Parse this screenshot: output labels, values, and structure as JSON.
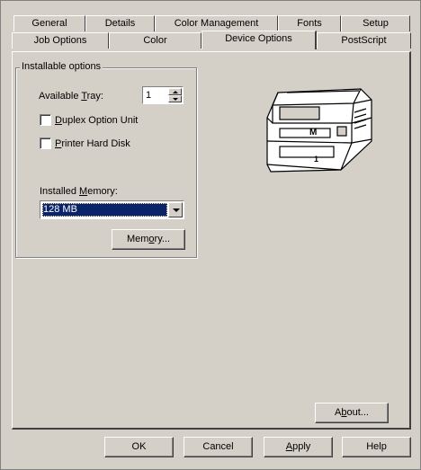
{
  "tabs_back": [
    {
      "pre": "General",
      "u": "",
      "post": ""
    },
    {
      "pre": "Details",
      "u": "",
      "post": ""
    },
    {
      "pre": "Color Management",
      "u": "",
      "post": ""
    },
    {
      "pre": "Fonts",
      "u": "",
      "post": ""
    },
    {
      "pre": "Setup",
      "u": "",
      "post": ""
    }
  ],
  "tabs_front": [
    {
      "pre": "Job Options",
      "u": "",
      "post": ""
    },
    {
      "pre": "Color",
      "u": "",
      "post": ""
    },
    {
      "pre": "Device Options",
      "u": "",
      "post": "",
      "active": true
    },
    {
      "pre": "PostScript",
      "u": "",
      "post": ""
    }
  ],
  "group": {
    "title": "Installable options"
  },
  "tray": {
    "label_pre": "Available ",
    "label_u": "T",
    "label_post": "ray:",
    "value": "1"
  },
  "duplex": {
    "pre": "",
    "u": "D",
    "post": "uplex Option Unit",
    "checked": false
  },
  "harddisk": {
    "pre": "",
    "u": "P",
    "post": "rinter Hard Disk",
    "checked": false
  },
  "memory": {
    "label_pre": "Installed ",
    "label_u": "M",
    "label_post": "emory:",
    "value": "128 MB"
  },
  "memory_button": {
    "pre": "Mem",
    "u": "o",
    "post": "ry..."
  },
  "printer_image": {
    "icon": "printer-icon",
    "drawer_letter": "M",
    "tray_number": "1"
  },
  "about_button": {
    "pre": "A",
    "u": "b",
    "post": "out..."
  },
  "footer": {
    "ok": {
      "pre": "OK",
      "u": "",
      "post": ""
    },
    "cancel": {
      "pre": "Cancel",
      "u": "",
      "post": ""
    },
    "apply": {
      "pre": "",
      "u": "A",
      "post": "pply"
    },
    "help": {
      "pre": "Help",
      "u": "",
      "post": ""
    }
  }
}
